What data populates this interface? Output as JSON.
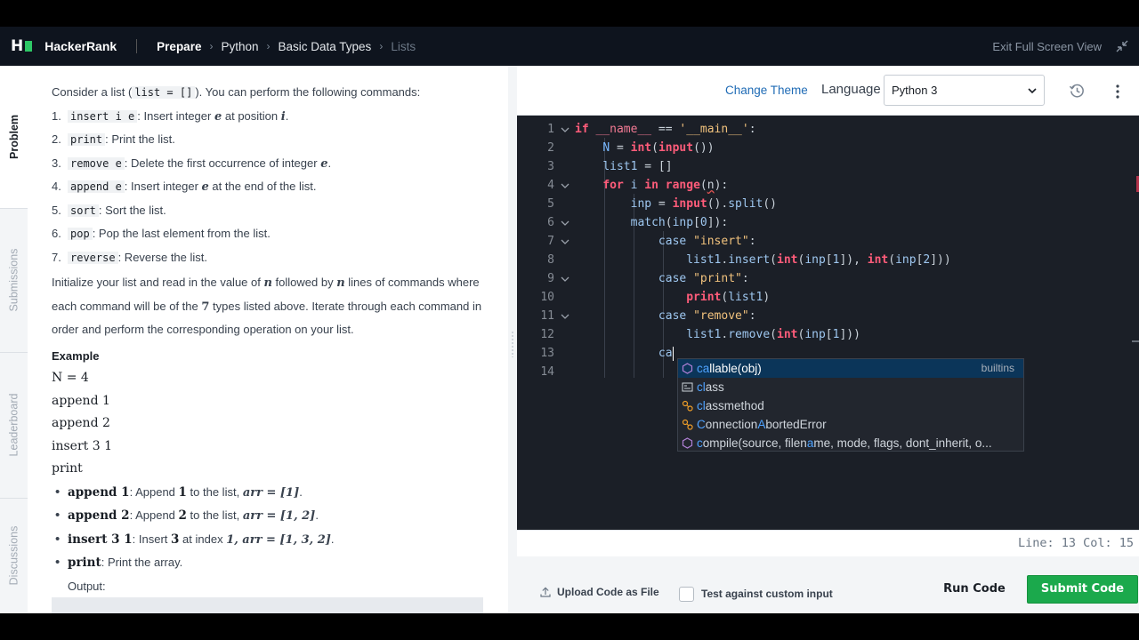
{
  "header": {
    "logo_text": "H",
    "brand": "HackerRank",
    "breadcrumbs": [
      "Prepare",
      "Python",
      "Basic Data Types",
      "Lists"
    ],
    "exit_fullscreen": "Exit Full Screen View"
  },
  "side_tabs": [
    "Problem",
    "Submissions",
    "Leaderboard",
    "Discussions"
  ],
  "problem": {
    "intro_pre": "Consider a list (",
    "intro_code": "list = []",
    "intro_post": "). You can perform the following commands:",
    "commands": [
      {
        "num": "1.",
        "code": "insert i e",
        "text_pre": ": Insert integer ",
        "var1": "e",
        "text_mid": " at position ",
        "var2": "i",
        "text_post": "."
      },
      {
        "num": "2.",
        "code": "print",
        "text_pre": ": Print the list.",
        "var1": "",
        "text_mid": "",
        "var2": "",
        "text_post": ""
      },
      {
        "num": "3.",
        "code": "remove e",
        "text_pre": ": Delete the first occurrence of integer ",
        "var1": "e",
        "text_mid": "",
        "var2": "",
        "text_post": "."
      },
      {
        "num": "4.",
        "code": "append e",
        "text_pre": ": Insert integer ",
        "var1": "e",
        "text_mid": " at the end of the list.",
        "var2": "",
        "text_post": ""
      },
      {
        "num": "5.",
        "code": "sort",
        "text_pre": ": Sort the list.",
        "var1": "",
        "text_mid": "",
        "var2": "",
        "text_post": ""
      },
      {
        "num": "6.",
        "code": "pop",
        "text_pre": ": Pop the last element from the list.",
        "var1": "",
        "text_mid": "",
        "var2": "",
        "text_post": ""
      },
      {
        "num": "7.",
        "code": "reverse",
        "text_pre": ": Reverse the list.",
        "var1": "",
        "text_mid": "",
        "var2": "",
        "text_post": ""
      }
    ],
    "para2_a": "Initialize your list and read in the value of ",
    "para2_n1": "n",
    "para2_b": " followed by ",
    "para2_n2": "n",
    "para2_c": " lines of commands where each command will be of the ",
    "para2_seven": "7",
    "para2_d": " types listed above. Iterate through each command in order and perform the corresponding operation on your list.",
    "example_heading": "Example",
    "example_lines": [
      "N = 4",
      "append 1",
      "append 2",
      "insert 3 1",
      "print"
    ],
    "bullets": [
      {
        "bold": "append 1",
        "pre": ": Append ",
        "num": "1",
        "post": " to the list, ",
        "math": "arr = [1]",
        "end": "."
      },
      {
        "bold": "append 2",
        "pre": ": Append ",
        "num": "2",
        "post": " to the list, ",
        "math": "arr = [1, 2]",
        "end": "."
      },
      {
        "bold": "insert 3 1",
        "pre": ": Insert ",
        "num": "3",
        "post": " at index ",
        "math": "1, arr = [1, 3, 2]",
        "end": "."
      },
      {
        "bold": "print",
        "pre": ": Print the array.",
        "num": "",
        "post": "",
        "math": "",
        "end": ""
      }
    ],
    "output_label": "Output:"
  },
  "toolbar": {
    "change_theme": "Change Theme",
    "language_label": "Language",
    "language_value": "Python 3"
  },
  "editor": {
    "line_numbers": [
      "1",
      "2",
      "3",
      "4",
      "5",
      "6",
      "7",
      "8",
      "9",
      "10",
      "11",
      "12",
      "13",
      "14"
    ],
    "code_text": [
      "if __name__ == '__main__':",
      "    N = int(input())",
      "    list1 = []",
      "    for i in range(n):",
      "        inp = input().split()",
      "        match(inp[0]):",
      "            case \"insert\":",
      "                list1.insert(int(inp[1]), int(inp[2]))",
      "            case \"print\":",
      "                print(list1)",
      "            case \"remove\":",
      "                list1.remove(int(inp[1]))",
      "            ca",
      ""
    ],
    "status": "Line: 13 Col: 15"
  },
  "autocomplete": {
    "items": [
      {
        "match": "ca",
        "rest": "llable(obj)",
        "detail": "builtins",
        "icon": "function-icon"
      },
      {
        "match": "cl",
        "rest": "a",
        "rest2": "ss",
        "detail": "",
        "icon": "keyword-icon"
      },
      {
        "match": "cl",
        "rest": "assmethod",
        "detail": "",
        "icon": "class-icon"
      },
      {
        "match": "C",
        "rest": "onnection",
        "rest2": "A",
        "rest3": "bortedError",
        "detail": "",
        "icon": "class-icon"
      },
      {
        "match": "c",
        "rest": "ompile(source, filen",
        "rest2": "a",
        "rest3": "me, mode, flags, dont_inherit, o...",
        "detail": "",
        "icon": "function-icon"
      }
    ]
  },
  "actions": {
    "upload": "Upload Code as File",
    "custom_input": "Test against custom input",
    "run": "Run Code",
    "submit": "Submit Code"
  },
  "colors": {
    "header_bg": "#0e141e",
    "editor_bg": "#1b1f27",
    "submit_green": "#1ba94c",
    "link_blue": "#1f6bb5"
  }
}
